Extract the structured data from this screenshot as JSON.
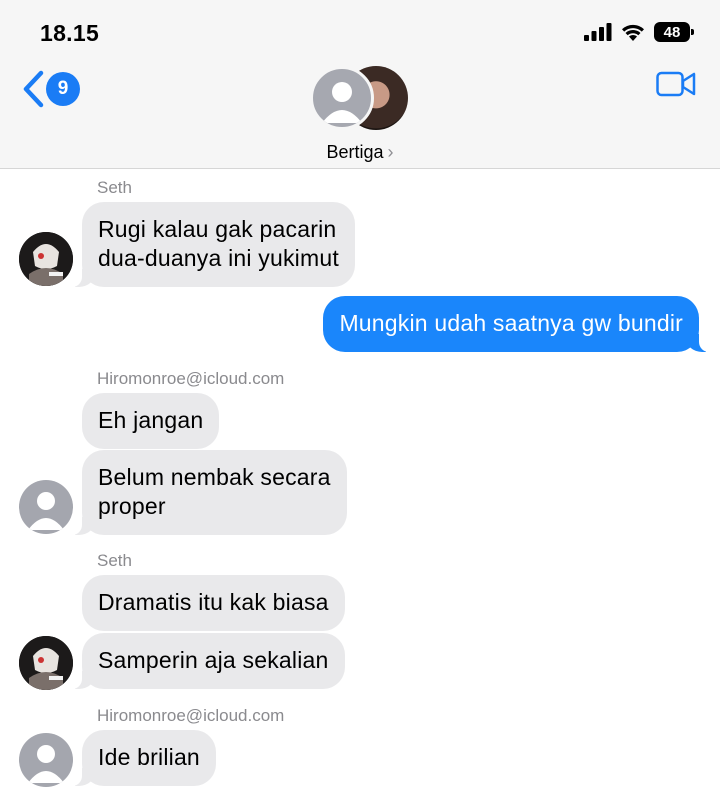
{
  "status_bar": {
    "time": "18.15",
    "battery": "48"
  },
  "header": {
    "back_count": "9",
    "group_name": "Bertiga",
    "chevron": "›"
  },
  "messages": [
    {
      "sender": "Seth"
    },
    {
      "text": "Rugi kalau gak pacarin\ndua-duanya ini yukimut"
    },
    {
      "text": "Mungkin udah saatnya gw bundir"
    },
    {
      "sender": "Hiromonroe@icloud.com"
    },
    {
      "text": "Eh jangan"
    },
    {
      "text": "Belum nembak secara\nproper"
    },
    {
      "sender": "Seth"
    },
    {
      "text": "Dramatis itu kak biasa"
    },
    {
      "text": "Samperin aja sekalian"
    },
    {
      "sender": "Hiromonroe@icloud.com"
    },
    {
      "text": "Ide brilian"
    }
  ],
  "colors": {
    "accent": "#1a86fb",
    "incoming_bubble": "#e9e9eb",
    "badge": "#1a7cf5"
  }
}
